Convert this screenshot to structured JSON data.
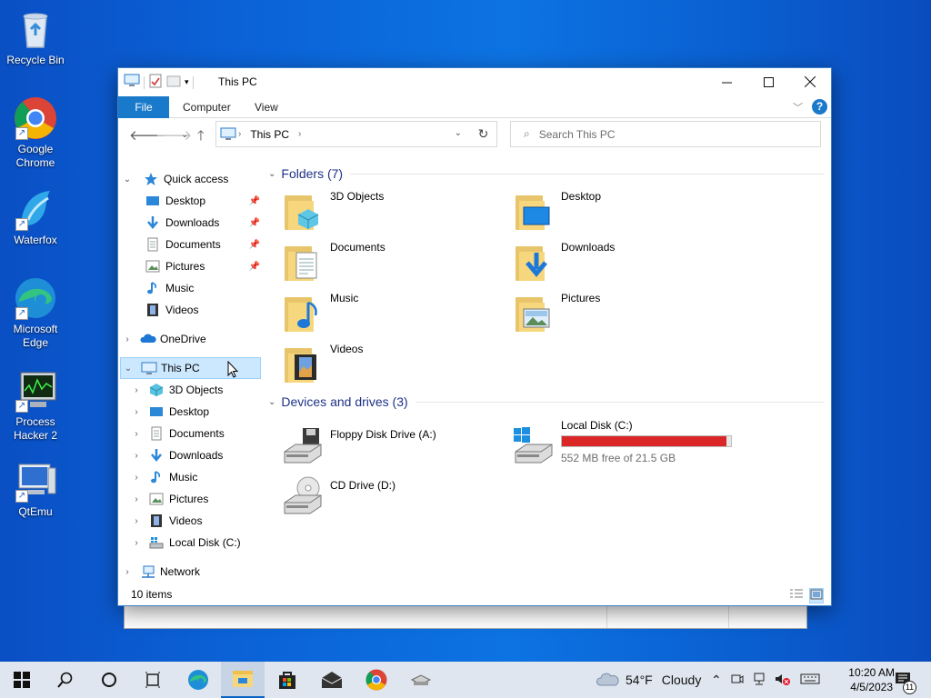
{
  "desktop": {
    "icons": [
      {
        "label": "Recycle Bin",
        "icon": "recycle-bin-icon"
      },
      {
        "label": "Google Chrome",
        "icon": "chrome-icon"
      },
      {
        "label": "Waterfox",
        "icon": "waterfox-icon"
      },
      {
        "label": "Microsoft Edge",
        "icon": "edge-icon"
      },
      {
        "label": "Process Hacker 2",
        "icon": "process-hacker-icon"
      },
      {
        "label": "QtEmu",
        "icon": "qtemu-icon"
      }
    ]
  },
  "window": {
    "title": "This PC",
    "tabs": {
      "file": "File",
      "computer": "Computer",
      "view": "View"
    },
    "address": {
      "location": "This PC"
    },
    "search": {
      "placeholder": "Search This PC"
    },
    "nav": {
      "quick_access": "Quick access",
      "qa_items": [
        "Desktop",
        "Downloads",
        "Documents",
        "Pictures",
        "Music",
        "Videos"
      ],
      "onedrive": "OneDrive",
      "this_pc": "This PC",
      "pc_items": [
        "3D Objects",
        "Desktop",
        "Documents",
        "Downloads",
        "Music",
        "Pictures",
        "Videos",
        "Local Disk (C:)"
      ],
      "network": "Network"
    },
    "content": {
      "folders_header": "Folders (7)",
      "folders": [
        "3D Objects",
        "Desktop",
        "Documents",
        "Downloads",
        "Music",
        "Pictures",
        "Videos"
      ],
      "devices_header": "Devices and drives (3)",
      "drives": {
        "floppy": "Floppy Disk Drive (A:)",
        "local": "Local Disk (C:)",
        "local_free": "552 MB free of 21.5 GB",
        "local_used_fraction": 0.975,
        "cd": "CD Drive (D:)"
      }
    },
    "status": "10 items"
  },
  "taskbar": {
    "weather_temp": "54°F",
    "weather_desc": "Cloudy",
    "time": "10:20 AM",
    "date": "4/5/2023",
    "notification_count": "11"
  },
  "colors": {
    "accent": "#1979ca",
    "capacity_bar": "#da2626",
    "group_header": "#1e3287"
  }
}
